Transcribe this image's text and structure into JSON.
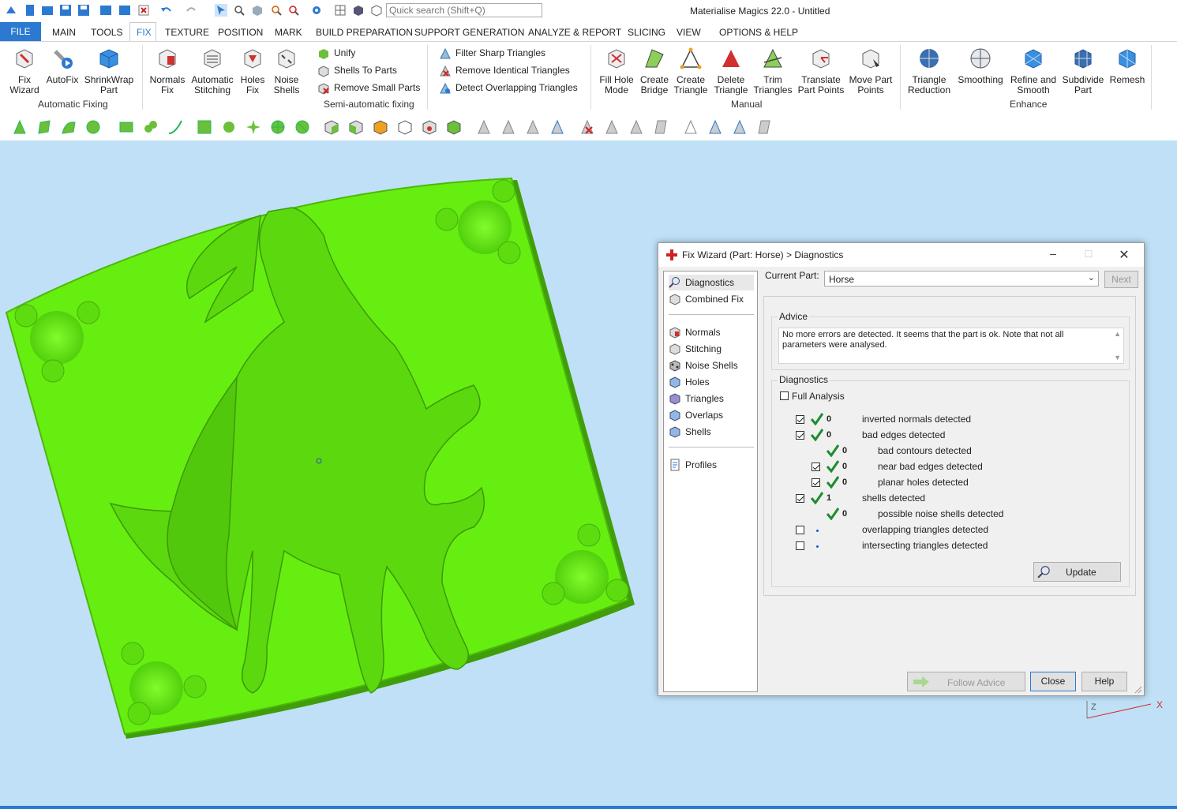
{
  "app": {
    "title": "Materialise Magics 22.0 - Untitled",
    "search_placeholder": "Quick search (Shift+Q)"
  },
  "quick_access": [
    "app-logo-icon",
    "new-icon",
    "open-icon",
    "save-icon",
    "save-as-icon",
    "save-all-icon",
    "import-icon",
    "export-icon",
    "delete-part-icon",
    "undo-icon",
    "redo-icon",
    "select-mode-icon",
    "zoom-fit-icon",
    "part-view-icon",
    "zoom-icon",
    "zoom-out-icon",
    "settings-icon",
    "grid-icon",
    "part-icon",
    "box-icon"
  ],
  "menu": {
    "file": "FILE",
    "tabs": [
      "MAIN",
      "TOOLS",
      "FIX",
      "TEXTURE",
      "POSITION",
      "MARK",
      "BUILD PREPARATION",
      "SUPPORT GENERATION",
      "ANALYZE & REPORT",
      "SLICING",
      "VIEW",
      "OPTIONS & HELP"
    ],
    "active_tab": "FIX"
  },
  "ribbon": {
    "automatic_fixing": {
      "label": "Automatic Fixing",
      "buttons": [
        {
          "line1": "Fix",
          "line2": "Wizard"
        },
        {
          "line1": "AutoFix",
          "line2": ""
        },
        {
          "line1": "ShrinkWrap",
          "line2": "Part"
        }
      ]
    },
    "semi_automatic": {
      "label": "Semi-automatic fixing",
      "buttons": [
        {
          "line1": "Normals",
          "line2": "Fix"
        },
        {
          "line1": "Automatic",
          "line2": "Stitching"
        },
        {
          "line1": "Holes",
          "line2": "Fix"
        },
        {
          "line1": "Noise",
          "line2": "Shells"
        }
      ],
      "small": [
        "Unify",
        "Shells To Parts",
        "Remove Small Parts",
        "Filter Sharp Triangles",
        "Remove Identical Triangles",
        "Detect Overlapping Triangles"
      ]
    },
    "manual": {
      "label": "Manual",
      "buttons": [
        {
          "line1": "Fill Hole",
          "line2": "Mode"
        },
        {
          "line1": "Create",
          "line2": "Bridge"
        },
        {
          "line1": "Create",
          "line2": "Triangle"
        },
        {
          "line1": "Delete",
          "line2": "Triangle"
        },
        {
          "line1": "Trim",
          "line2": "Triangles"
        },
        {
          "line1": "Translate",
          "line2": "Part Points"
        },
        {
          "line1": "Move Part",
          "line2": "Points"
        }
      ]
    },
    "enhance": {
      "label": "Enhance",
      "buttons": [
        {
          "line1": "Triangle",
          "line2": "Reduction"
        },
        {
          "line1": "Smoothing",
          "line2": ""
        },
        {
          "line1": "Refine and",
          "line2": "Smooth"
        },
        {
          "line1": "Subdivide",
          "line2": "Part"
        },
        {
          "line1": "Remesh",
          "line2": ""
        }
      ]
    }
  },
  "colors": {
    "accent": "#2b79d0",
    "viewport_bg": "#bfe0f6",
    "part_green": "#66ee11",
    "check_green": "#1e8c2e",
    "axis_red": "#d03030"
  },
  "dialog": {
    "title": "Fix Wizard (Part: Horse) > Diagnostics",
    "nav": [
      "Diagnostics",
      "Combined Fix",
      "Normals",
      "Stitching",
      "Noise Shells",
      "Holes",
      "Triangles",
      "Overlaps",
      "Shells",
      "Profiles"
    ],
    "current_part_label": "Current Part:",
    "current_part": "Horse",
    "next_label": "Next",
    "advice_legend": "Advice",
    "advice_text": "No more errors are detected. It seems that the part is ok. Note that not all parameters were analysed.",
    "diagnostics_legend": "Diagnostics",
    "full_analysis_label": "Full Analysis",
    "rows": [
      {
        "checkbox": "checked",
        "status": "ok",
        "count": "0",
        "label": "inverted normals detected",
        "indent": 0
      },
      {
        "checkbox": "checked",
        "status": "ok",
        "count": "0",
        "label": "bad edges detected",
        "indent": 0
      },
      {
        "checkbox": "none",
        "status": "ok",
        "count": "0",
        "label": "bad contours detected",
        "indent": 1
      },
      {
        "checkbox": "checked",
        "status": "ok",
        "count": "0",
        "label": "near bad edges detected",
        "indent": 1
      },
      {
        "checkbox": "checked",
        "status": "ok",
        "count": "0",
        "label": "planar holes detected",
        "indent": 1
      },
      {
        "checkbox": "checked",
        "status": "ok",
        "count": "1",
        "label": "shells detected",
        "indent": 0
      },
      {
        "checkbox": "none",
        "status": "ok",
        "count": "0",
        "label": "possible noise shells detected",
        "indent": 1
      },
      {
        "checkbox": "unchecked",
        "status": "dot",
        "count": "",
        "label": "overlapping triangles detected",
        "indent": 0
      },
      {
        "checkbox": "unchecked",
        "status": "dot",
        "count": "",
        "label": "intersecting triangles detected",
        "indent": 0
      }
    ],
    "update_label": "Update",
    "follow_advice_label": "Follow Advice",
    "close_label": "Close",
    "help_label": "Help"
  },
  "axis": {
    "z": "Z",
    "x": "X"
  }
}
